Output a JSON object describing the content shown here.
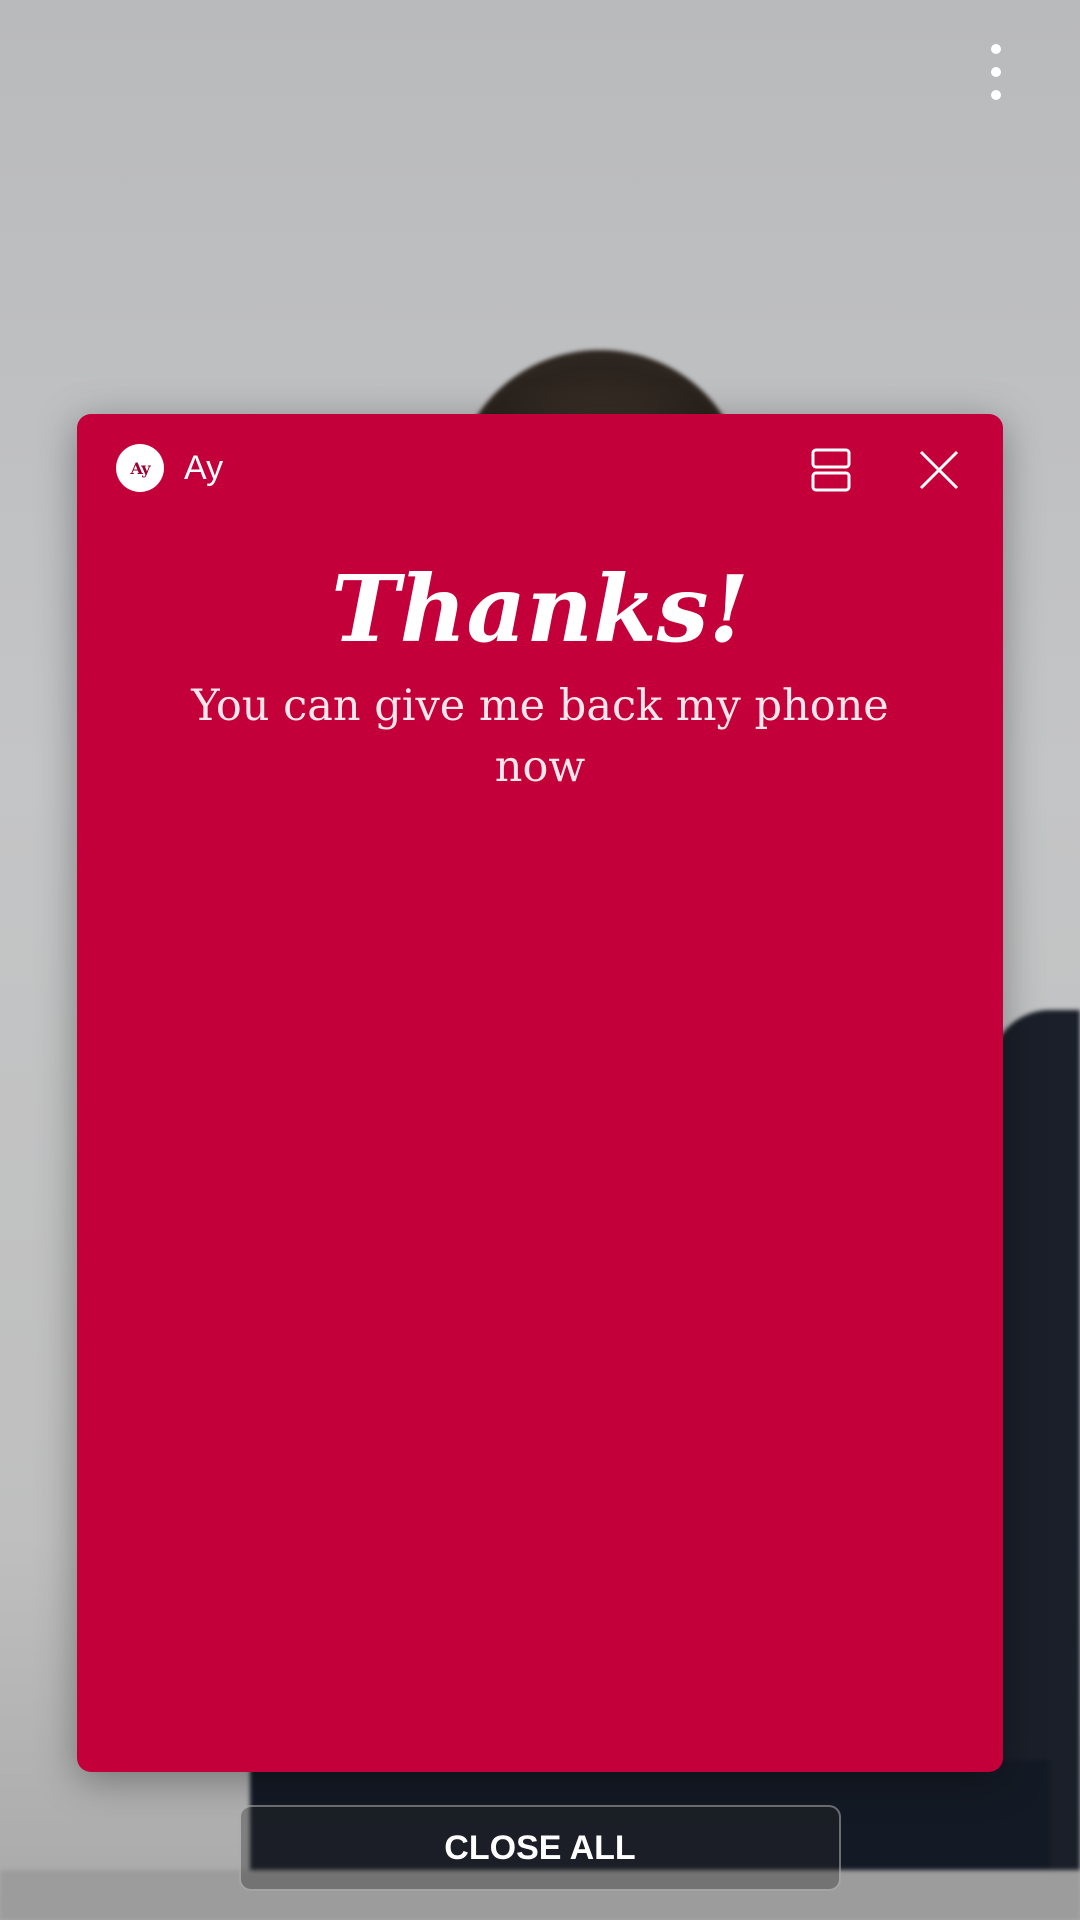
{
  "overflow_menu": {
    "icon": "more-vert-icon"
  },
  "app_card": {
    "app_name": "Ay",
    "app_icon_text": "Ay",
    "background_color": "#c4003a",
    "split_view_icon": "split-screen-icon",
    "close_icon": "close-icon",
    "title": "Thanks!",
    "message": "You can give me back my phone now"
  },
  "close_all_label": "CLOSE ALL"
}
